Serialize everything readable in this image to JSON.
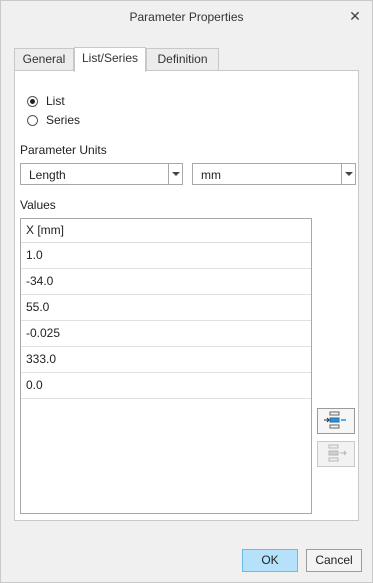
{
  "window": {
    "title": "Parameter Properties",
    "close_glyph": "✕"
  },
  "tabs": [
    {
      "label": "General",
      "active": false
    },
    {
      "label": "List/Series",
      "active": true
    },
    {
      "label": "Definition",
      "active": false
    }
  ],
  "mode": {
    "options": [
      {
        "label": "List",
        "checked": true
      },
      {
        "label": "Series",
        "checked": false
      }
    ]
  },
  "units": {
    "label": "Parameter Units",
    "quantity": "Length",
    "unit": "mm"
  },
  "values": {
    "label": "Values",
    "column_header": "X [mm]",
    "rows": [
      "1.0",
      "-34.0",
      "55.0",
      "-0.025",
      "333.0",
      "0.0"
    ]
  },
  "side_buttons": [
    {
      "icon": "insert-row-icon",
      "enabled": true
    },
    {
      "icon": "remove-row-icon",
      "enabled": false
    }
  ],
  "footer": {
    "ok_label": "OK",
    "cancel_label": "Cancel"
  },
  "colors": {
    "ok_accent": "#b5e2fa",
    "icon_blue": "#2e8fd4"
  }
}
